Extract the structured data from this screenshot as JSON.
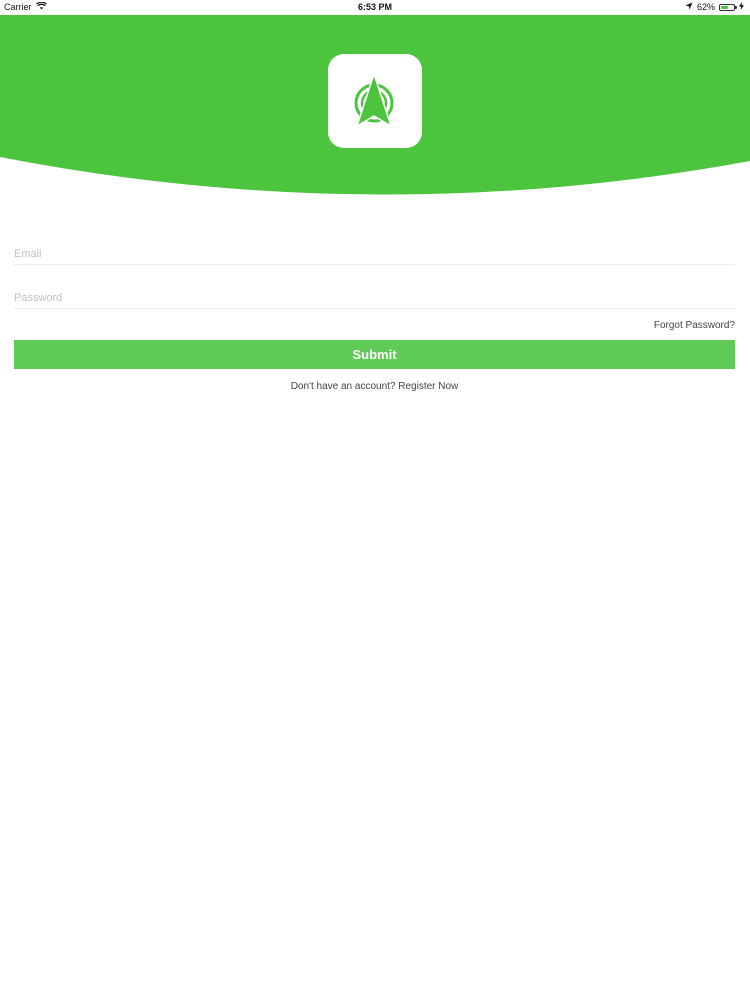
{
  "status_bar": {
    "carrier": "Carrier",
    "time": "6:53 PM",
    "battery_percent": "62%",
    "battery_level": 0.62,
    "wifi_icon": "wifi-icon",
    "location_icon": "location-arrow-icon",
    "charging_icon": "charging-bolt-icon"
  },
  "colors": {
    "brand_green": "#4cc43e",
    "button_green": "#5fcb56",
    "logo_green": "#4cc43e"
  },
  "logo": {
    "icon": "navigation-arrow-logo-icon"
  },
  "form": {
    "email_placeholder": "Email",
    "email_value": "",
    "password_placeholder": "Password",
    "password_value": "",
    "forgot_label": "Forgot Password?",
    "submit_label": "Submit",
    "register_prompt": "Don't have an account?",
    "register_link": "Register Now"
  }
}
